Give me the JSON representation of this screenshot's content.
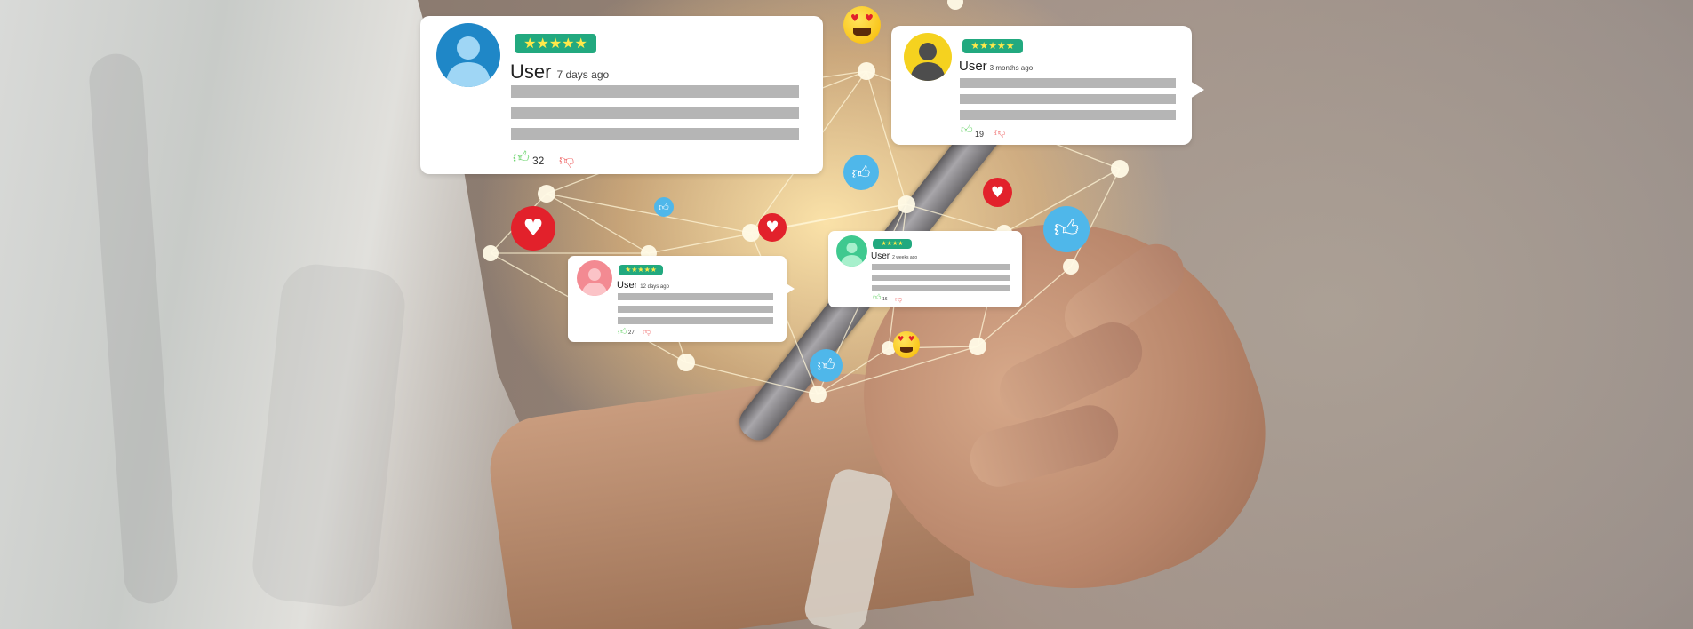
{
  "reviews": [
    {
      "user": "User",
      "ago": "7 days ago",
      "stars": "★★★★★",
      "likes": "32"
    },
    {
      "user": "User",
      "ago": "3 months ago",
      "stars": "★★★★★",
      "likes": "19"
    },
    {
      "user": "User",
      "ago": "12 days ago",
      "stars": "★★★★★",
      "likes": "27"
    },
    {
      "user": "User",
      "ago": "2 weeks ago",
      "stars": "★★★★",
      "likes": "16"
    }
  ],
  "icons": {
    "like": "thumbs-up-icon",
    "dislike": "thumbs-down-icon",
    "heart": "heart-icon",
    "emoji": "heart-eyes-emoji-icon"
  },
  "colors": {
    "star_badge": "#22a97f",
    "star": "#ffe94a",
    "like_bubble": "#4fb7ea",
    "heart_bubble": "#e2212b",
    "like_thumb": "#69d36a",
    "dislike_thumb": "#f06f6f",
    "skeleton_bar": "#b5b5b5"
  }
}
